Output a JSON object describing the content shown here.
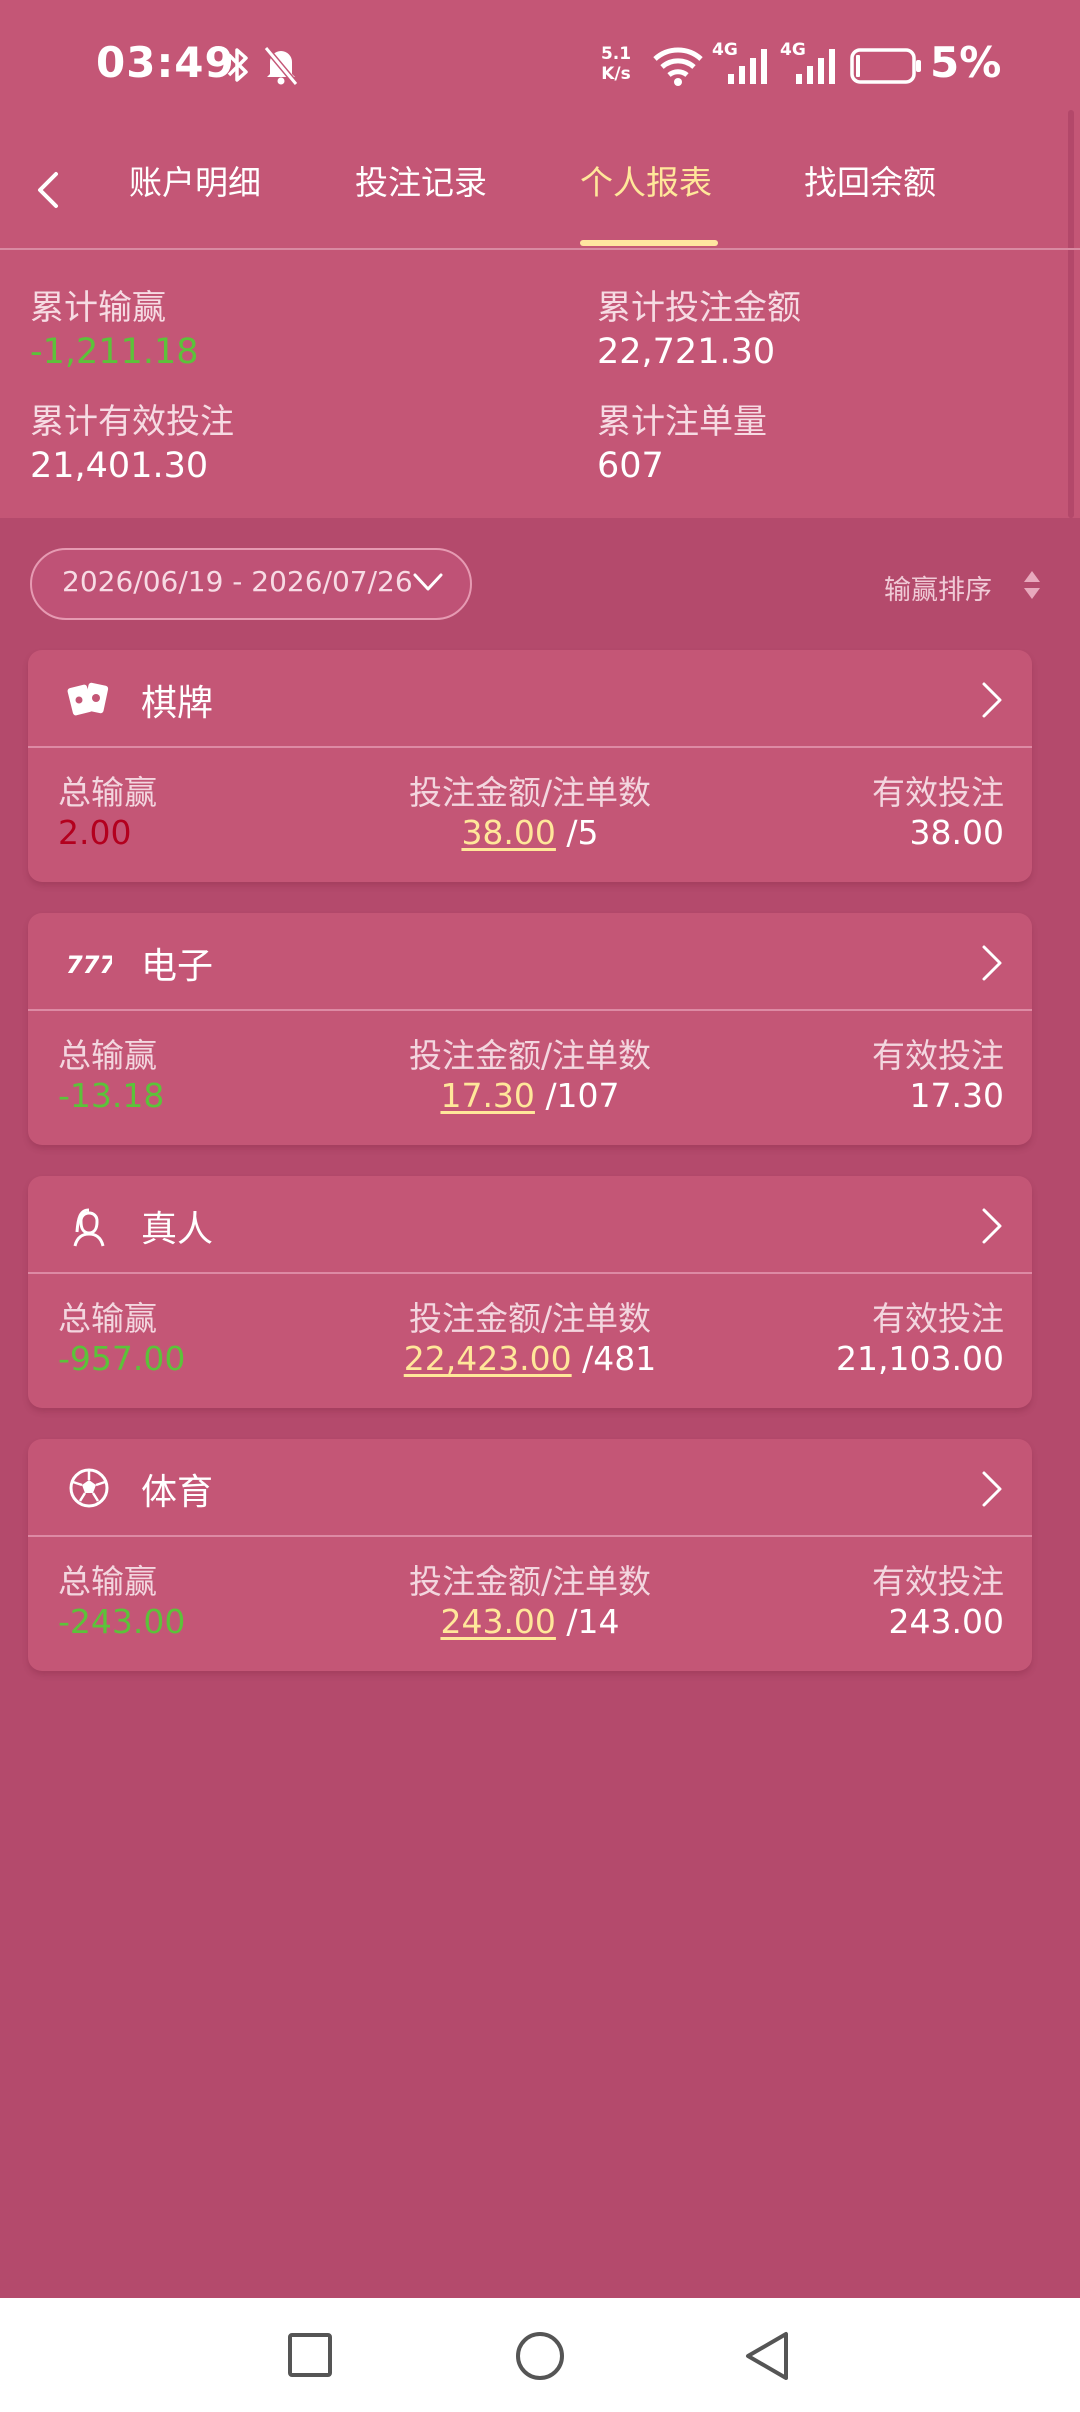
{
  "status": {
    "time": "03:49",
    "speed_top": "5.1",
    "speed_bottom": "K/s",
    "net1": "4G",
    "net2": "4G",
    "battery": "5%"
  },
  "nav": {
    "tabs": [
      {
        "label": "账户明细"
      },
      {
        "label": "投注记录"
      },
      {
        "label": "个人报表"
      },
      {
        "label": "找回余额"
      }
    ],
    "active_tab": "个人报表"
  },
  "summary": {
    "total_win_loss_label": "累计输赢",
    "total_win_loss": "-1,211.18",
    "total_bet_label": "累计投注金额",
    "total_bet": "22,721.30",
    "valid_bet_label": "累计有效投注",
    "valid_bet": "21,401.30",
    "order_count_label": "累计注单量",
    "order_count": "607"
  },
  "filter": {
    "date_range": "2026/06/19 - 2026/07/26",
    "sort_label": "输赢排序"
  },
  "columns": {
    "win_loss": "总输赢",
    "bet_orders": "投注金额/注单数",
    "valid_bet": "有效投注"
  },
  "categories": [
    {
      "title": "棋牌",
      "icon": "cards-icon",
      "win_loss": "2.00",
      "bet_amount": "38.00",
      "orders": "/5",
      "valid_bet": "38.00"
    },
    {
      "title": "电子",
      "icon": "slot-777-icon",
      "win_loss": "-13.18",
      "bet_amount": "17.30",
      "orders": "/107",
      "valid_bet": "17.30"
    },
    {
      "title": "真人",
      "icon": "dealer-icon",
      "win_loss": "-957.00",
      "bet_amount": "22,423.00",
      "orders": "/481",
      "valid_bet": "21,103.00"
    },
    {
      "title": "体育",
      "icon": "soccer-ball-icon",
      "win_loss": "-243.00",
      "bet_amount": "243.00",
      "orders": "/14",
      "valid_bet": "243.00"
    }
  ],
  "colors": {
    "background": "#b44a6c",
    "panel": "#c45676",
    "accent": "#ffe79a",
    "negative": "#5cc23a",
    "positive": "#b3001e"
  }
}
